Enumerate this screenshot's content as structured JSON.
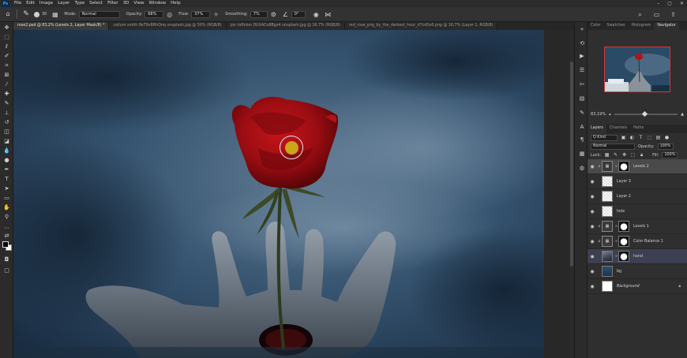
{
  "app": {
    "logo_text": "Ps"
  },
  "menu": [
    "File",
    "Edit",
    "Image",
    "Layer",
    "Type",
    "Select",
    "Filter",
    "3D",
    "View",
    "Window",
    "Help"
  ],
  "window_controls": [
    "–",
    "▢",
    "✕"
  ],
  "options_bar": {
    "brush_size": "30",
    "mode_label": "Mode:",
    "mode_value": "Normal",
    "opacity_label": "Opacity:",
    "opacity_value": "68%",
    "flow_label": "Flow:",
    "flow_value": "37%",
    "smoothing_label": "Smoothing:",
    "smoothing_value": "7%",
    "angle_value": "0°"
  },
  "doc_tabs": [
    {
      "label": "rose2.psd @ 83,2% (Levels 2, Layer Mask/8) *",
      "active": true
    },
    {
      "label": "callum smith 8eT9v8RhOnq unsplash.jpg @ 50% (RGB/8)",
      "active": false
    },
    {
      "label": "jon toffolon DUXACo8Bgx4 unsplash.jpg @ 16,7% (RGB/8)",
      "active": false
    },
    {
      "label": "red_rose_png_by_the_darkest_hour_d7cd0v6.png @ 16,7% (Layer 1, RGB/8)",
      "active": false
    }
  ],
  "right_panel": {
    "top_tabs": [
      "Color",
      "Swatches",
      "Histogram",
      "Navigator"
    ],
    "active_top_tab": "Navigator",
    "zoom": "83,19%",
    "layer_tabs": [
      "Layers",
      "Channels",
      "Paths"
    ],
    "active_layer_tab": "Layers",
    "filter_label": "Q Kind",
    "blend_mode": "Normal",
    "opacity_label": "Opacity:",
    "opacity_value": "100%",
    "lock_label": "Lock:",
    "fill_label": "Fill:",
    "fill_value": "100%"
  },
  "layers": [
    {
      "name": "Levels 2",
      "thumb": "adj",
      "mask": true,
      "clipped": true,
      "state": "active"
    },
    {
      "name": "Layer 3",
      "thumb": "checker",
      "mask": false,
      "clipped": false,
      "state": ""
    },
    {
      "name": "Layer 2",
      "thumb": "checker",
      "mask": false,
      "clipped": false,
      "state": ""
    },
    {
      "name": "hole",
      "thumb": "checker",
      "mask": false,
      "clipped": false,
      "state": ""
    },
    {
      "name": "Levels 1",
      "thumb": "adj",
      "mask": true,
      "clipped": true,
      "state": ""
    },
    {
      "name": "Color Balance 1",
      "thumb": "adj",
      "mask": true,
      "clipped": true,
      "state": ""
    },
    {
      "name": "hand",
      "thumb": "hand",
      "mask": true,
      "clipped": false,
      "state": "selected"
    },
    {
      "name": "bg",
      "thumb": "sky",
      "mask": false,
      "clipped": false,
      "state": ""
    },
    {
      "name": "Background",
      "thumb": "white",
      "mask": false,
      "clipped": false,
      "state": "",
      "locked": true,
      "italic": true
    }
  ]
}
